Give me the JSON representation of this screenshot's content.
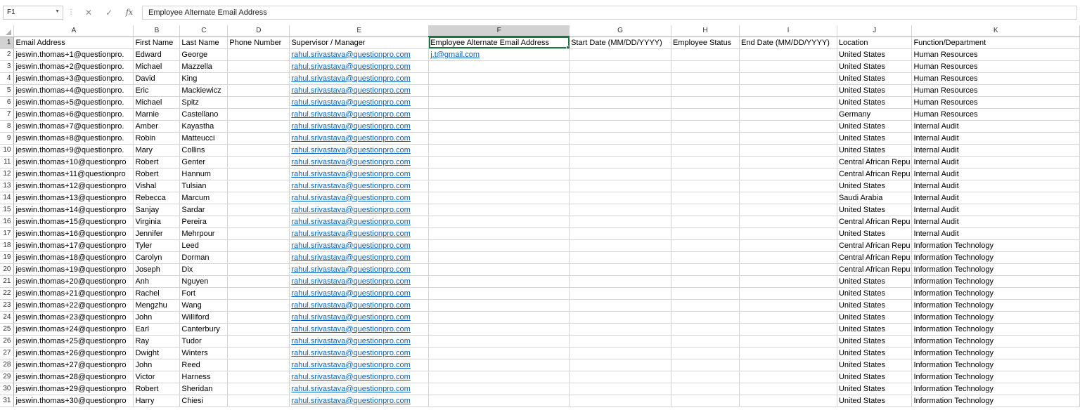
{
  "formula_bar": {
    "cell_ref": "F1",
    "separator": "⋮",
    "cancel_icon": "✕",
    "enter_icon": "✓",
    "fx_label": "fx",
    "value": "Employee Alternate Email Address"
  },
  "active_cell": "F1",
  "accent_color": "#217346",
  "link_color": "#0563c1",
  "columns": [
    "A",
    "B",
    "C",
    "D",
    "E",
    "F",
    "G",
    "H",
    "I",
    "J",
    "K"
  ],
  "rows": [
    [
      "Email Address",
      "First Name",
      "Last Name",
      "Phone Number",
      "Supervisor / Manager",
      "Employee Alternate Email Address",
      "Start Date (MM/DD/YYYY)",
      "Employee Status",
      "End Date (MM/DD/YYYY)",
      "Location",
      "Function/Department"
    ],
    [
      "jeswin.thomas+1@questionpro.",
      "Edward",
      "George",
      "",
      "rahul.srivastava@questionpro.com",
      "j.t@gmail.com",
      "",
      "",
      "",
      "United States",
      "Human Resources"
    ],
    [
      "jeswin.thomas+2@questionpro.",
      "Michael",
      "Mazzella",
      "",
      "rahul.srivastava@questionpro.com",
      "",
      "",
      "",
      "",
      "United States",
      "Human Resources"
    ],
    [
      "jeswin.thomas+3@questionpro.",
      "David",
      "King",
      "",
      "rahul.srivastava@questionpro.com",
      "",
      "",
      "",
      "",
      "United States",
      "Human Resources"
    ],
    [
      "jeswin.thomas+4@questionpro.",
      "Eric",
      "Mackiewicz",
      "",
      "rahul.srivastava@questionpro.com",
      "",
      "",
      "",
      "",
      "United States",
      "Human Resources"
    ],
    [
      "jeswin.thomas+5@questionpro.",
      "Michael",
      "Spitz",
      "",
      "rahul.srivastava@questionpro.com",
      "",
      "",
      "",
      "",
      "United States",
      "Human Resources"
    ],
    [
      "jeswin.thomas+6@questionpro.",
      "Marnie",
      "Castellano",
      "",
      "rahul.srivastava@questionpro.com",
      "",
      "",
      "",
      "",
      "Germany",
      "Human Resources"
    ],
    [
      "jeswin.thomas+7@questionpro.",
      "Amber",
      "Kayastha",
      "",
      "rahul.srivastava@questionpro.com",
      "",
      "",
      "",
      "",
      "United States",
      "Internal Audit"
    ],
    [
      "jeswin.thomas+8@questionpro.",
      "Robin",
      "Matteucci",
      "",
      "rahul.srivastava@questionpro.com",
      "",
      "",
      "",
      "",
      "United States",
      "Internal Audit"
    ],
    [
      "jeswin.thomas+9@questionpro.",
      "Mary",
      "Collins",
      "",
      "rahul.srivastava@questionpro.com",
      "",
      "",
      "",
      "",
      "United States",
      "Internal Audit"
    ],
    [
      "jeswin.thomas+10@questionpro",
      "Robert",
      "Genter",
      "",
      "rahul.srivastava@questionpro.com",
      "",
      "",
      "",
      "",
      "Central African Repu",
      "Internal Audit"
    ],
    [
      "jeswin.thomas+11@questionpro",
      "Robert",
      "Hannum",
      "",
      "rahul.srivastava@questionpro.com",
      "",
      "",
      "",
      "",
      "Central African Repu",
      "Internal Audit"
    ],
    [
      "jeswin.thomas+12@questionpro",
      "Vishal",
      "Tulsian",
      "",
      "rahul.srivastava@questionpro.com",
      "",
      "",
      "",
      "",
      "United States",
      "Internal Audit"
    ],
    [
      "jeswin.thomas+13@questionpro",
      "Rebecca",
      "Marcum",
      "",
      "rahul.srivastava@questionpro.com",
      "",
      "",
      "",
      "",
      "Saudi Arabia",
      "Internal Audit"
    ],
    [
      "jeswin.thomas+14@questionpro",
      "Sanjay",
      "Sardar",
      "",
      "rahul.srivastava@questionpro.com",
      "",
      "",
      "",
      "",
      "United States",
      "Internal Audit"
    ],
    [
      "jeswin.thomas+15@questionpro",
      "Virginia",
      "Pereira",
      "",
      "rahul.srivastava@questionpro.com",
      "",
      "",
      "",
      "",
      "Central African Repu",
      "Internal Audit"
    ],
    [
      "jeswin.thomas+16@questionpro",
      "Jennifer",
      "Mehrpour",
      "",
      "rahul.srivastava@questionpro.com",
      "",
      "",
      "",
      "",
      "United States",
      "Internal Audit"
    ],
    [
      "jeswin.thomas+17@questionpro",
      "Tyler",
      "Leed",
      "",
      "rahul.srivastava@questionpro.com",
      "",
      "",
      "",
      "",
      "Central African Repu",
      "Information Technology"
    ],
    [
      "jeswin.thomas+18@questionpro",
      "Carolyn",
      "Dorman",
      "",
      "rahul.srivastava@questionpro.com",
      "",
      "",
      "",
      "",
      "Central African Repu",
      "Information Technology"
    ],
    [
      "jeswin.thomas+19@questionpro",
      "Joseph",
      "Dix",
      "",
      "rahul.srivastava@questionpro.com",
      "",
      "",
      "",
      "",
      "Central African Repu",
      "Information Technology"
    ],
    [
      "jeswin.thomas+20@questionpro",
      "Anh",
      "Nguyen",
      "",
      "rahul.srivastava@questionpro.com",
      "",
      "",
      "",
      "",
      "United States",
      "Information Technology"
    ],
    [
      "jeswin.thomas+21@questionpro",
      "Rachel",
      "Fort",
      "",
      "rahul.srivastava@questionpro.com",
      "",
      "",
      "",
      "",
      "United States",
      "Information Technology"
    ],
    [
      "jeswin.thomas+22@questionpro",
      "Mengzhu",
      "Wang",
      "",
      "rahul.srivastava@questionpro.com",
      "",
      "",
      "",
      "",
      "United States",
      "Information Technology"
    ],
    [
      "jeswin.thomas+23@questionpro",
      "John",
      "Williford",
      "",
      "rahul.srivastava@questionpro.com",
      "",
      "",
      "",
      "",
      "United States",
      "Information Technology"
    ],
    [
      "jeswin.thomas+24@questionpro",
      "Earl",
      "Canterbury",
      "",
      "rahul.srivastava@questionpro.com",
      "",
      "",
      "",
      "",
      "United States",
      "Information Technology"
    ],
    [
      "jeswin.thomas+25@questionpro",
      "Ray",
      "Tudor",
      "",
      "rahul.srivastava@questionpro.com",
      "",
      "",
      "",
      "",
      "United States",
      "Information Technology"
    ],
    [
      "jeswin.thomas+26@questionpro",
      "Dwight",
      "Winters",
      "",
      "rahul.srivastava@questionpro.com",
      "",
      "",
      "",
      "",
      "United States",
      "Information Technology"
    ],
    [
      "jeswin.thomas+27@questionpro",
      "John",
      "Reed",
      "",
      "rahul.srivastava@questionpro.com",
      "",
      "",
      "",
      "",
      "United States",
      "Information Technology"
    ],
    [
      "jeswin.thomas+28@questionpro",
      "Victor",
      "Harness",
      "",
      "rahul.srivastava@questionpro.com",
      "",
      "",
      "",
      "",
      "United States",
      "Information Technology"
    ],
    [
      "jeswin.thomas+29@questionpro",
      "Robert",
      "Sheridan",
      "",
      "rahul.srivastava@questionpro.com",
      "",
      "",
      "",
      "",
      "United States",
      "Information Technology"
    ],
    [
      "jeswin.thomas+30@questionpro",
      "Harry",
      "Chiesi",
      "",
      "rahul.srivastava@questionpro.com",
      "",
      "",
      "",
      "",
      "United States",
      "Information Technology"
    ]
  ]
}
